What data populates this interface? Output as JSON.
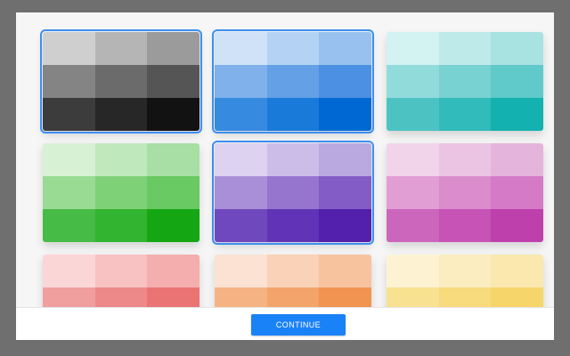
{
  "palettes": [
    {
      "name": "gray",
      "selected": true,
      "colors": [
        "#cfcfcf",
        "#b5b5b5",
        "#9b9b9b",
        "#848484",
        "#6b6b6b",
        "#555555",
        "#3c3c3c",
        "#272727",
        "#121212"
      ]
    },
    {
      "name": "blue",
      "selected": true,
      "colors": [
        "#cfe2f7",
        "#b4d2f3",
        "#98c1ef",
        "#80b1ea",
        "#64a0e6",
        "#4b90e2",
        "#368ae0",
        "#1a7ad9",
        "#0068d3"
      ]
    },
    {
      "name": "teal",
      "selected": false,
      "colors": [
        "#d3f2f2",
        "#bfeaea",
        "#a8e2e1",
        "#91dbda",
        "#78d2d1",
        "#5fcac9",
        "#4cc3c2",
        "#31bbba",
        "#13b1b0"
      ]
    },
    {
      "name": "green",
      "selected": false,
      "colors": [
        "#d7f1d5",
        "#c0e8bd",
        "#a8dfa4",
        "#99db93",
        "#7fd178",
        "#69c962",
        "#46bb45",
        "#32b430",
        "#14a713"
      ]
    },
    {
      "name": "purple",
      "selected": true,
      "colors": [
        "#ddd2ef",
        "#cbbde8",
        "#baa8e0",
        "#a98fd8",
        "#9675cf",
        "#845cc5",
        "#7048bd",
        "#6133b6",
        "#5220ad"
      ]
    },
    {
      "name": "magenta",
      "selected": false,
      "colors": [
        "#f1d4ea",
        "#ebc4e3",
        "#e5b4dc",
        "#e09ed5",
        "#da8ccd",
        "#d47ac6",
        "#cc66bd",
        "#c653b5",
        "#bd40ad"
      ]
    },
    {
      "name": "red",
      "selected": false,
      "colors": [
        "#fbd6d6",
        "#f8c2c2",
        "#f5aeae",
        "#f19e9e",
        "#ee8989",
        "#ea7474",
        "#e65f5f",
        "#e24a4a",
        "#de3434"
      ]
    },
    {
      "name": "orange",
      "selected": false,
      "colors": [
        "#fbe2d2",
        "#f9d2b8",
        "#f7c39f",
        "#f5b383",
        "#f3a46a",
        "#f19452",
        "#ef8538",
        "#ed761e",
        "#eb6604"
      ]
    },
    {
      "name": "yellow",
      "selected": false,
      "colors": [
        "#fdf3d2",
        "#fbedbf",
        "#fae8ae",
        "#f8e190",
        "#f7db7c",
        "#f6d66a",
        "#f4cf53",
        "#f3c93f",
        "#f2c32c"
      ]
    }
  ],
  "footer": {
    "continue_label": "CONTINUE"
  }
}
